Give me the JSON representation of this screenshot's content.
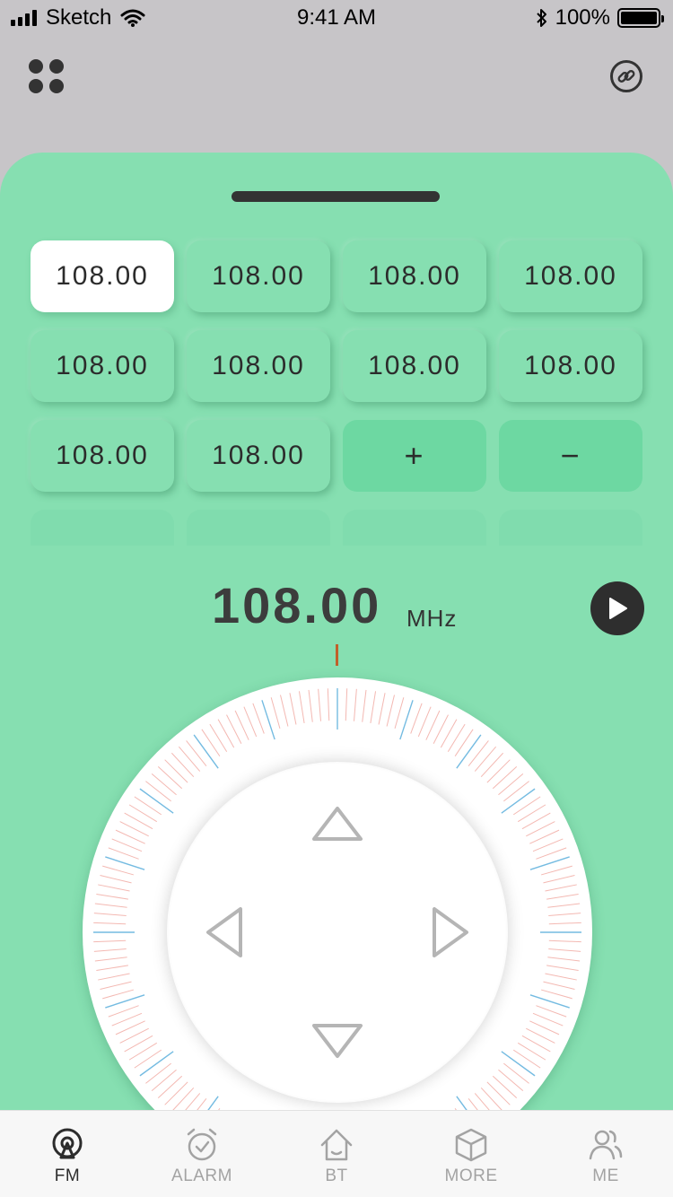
{
  "status_bar": {
    "carrier": "Sketch",
    "time": "9:41 AM",
    "battery": "100%"
  },
  "presets": [
    "108.00",
    "108.00",
    "108.00",
    "108.00",
    "108.00",
    "108.00",
    "108.00",
    "108.00",
    "108.00",
    "108.00"
  ],
  "preset_controls": {
    "add": "+",
    "remove": "−"
  },
  "tuner": {
    "frequency": "108.00",
    "unit": "MHz"
  },
  "tabs": [
    {
      "label": "FM",
      "icon": "radio-icon"
    },
    {
      "label": "ALARM",
      "icon": "alarm-clock-icon"
    },
    {
      "label": "BT",
      "icon": "home-icon"
    },
    {
      "label": "MORE",
      "icon": "cube-icon"
    },
    {
      "label": "ME",
      "icon": "users-icon"
    }
  ],
  "colors": {
    "sheet": "#86dfb1",
    "gray_top": "#c7c5c8",
    "needle": "#c0602a",
    "tick_blue": "#6db8e0",
    "tick_red": "#f1a79f"
  }
}
